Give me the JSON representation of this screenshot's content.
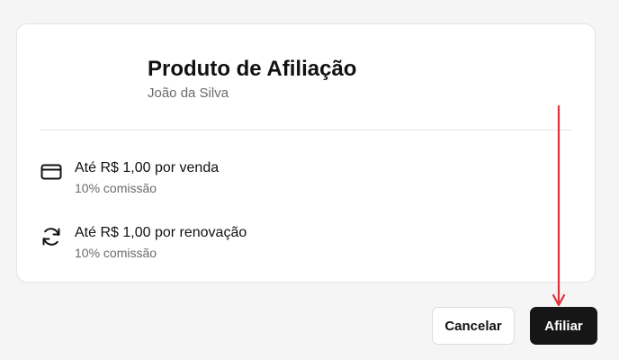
{
  "dialog": {
    "product_title": "Produto de Afiliação",
    "product_owner": "João da Silva",
    "rows": [
      {
        "icon": "credit-card-icon",
        "main_text": "Até R$ 1,00 por venda",
        "sub_text": "10% comissão"
      },
      {
        "icon": "refresh-icon",
        "main_text": "Até R$ 1,00 por renovação",
        "sub_text": "10% comissão"
      }
    ]
  },
  "actions": {
    "cancel_label": "Cancelar",
    "affiliate_label": "Afiliar"
  },
  "colors": {
    "background": "#f5f5f5",
    "card": "#ffffff",
    "primary_button": "#161616",
    "annotation_arrow": "#e0323c",
    "muted_text": "#6b6b6b"
  }
}
